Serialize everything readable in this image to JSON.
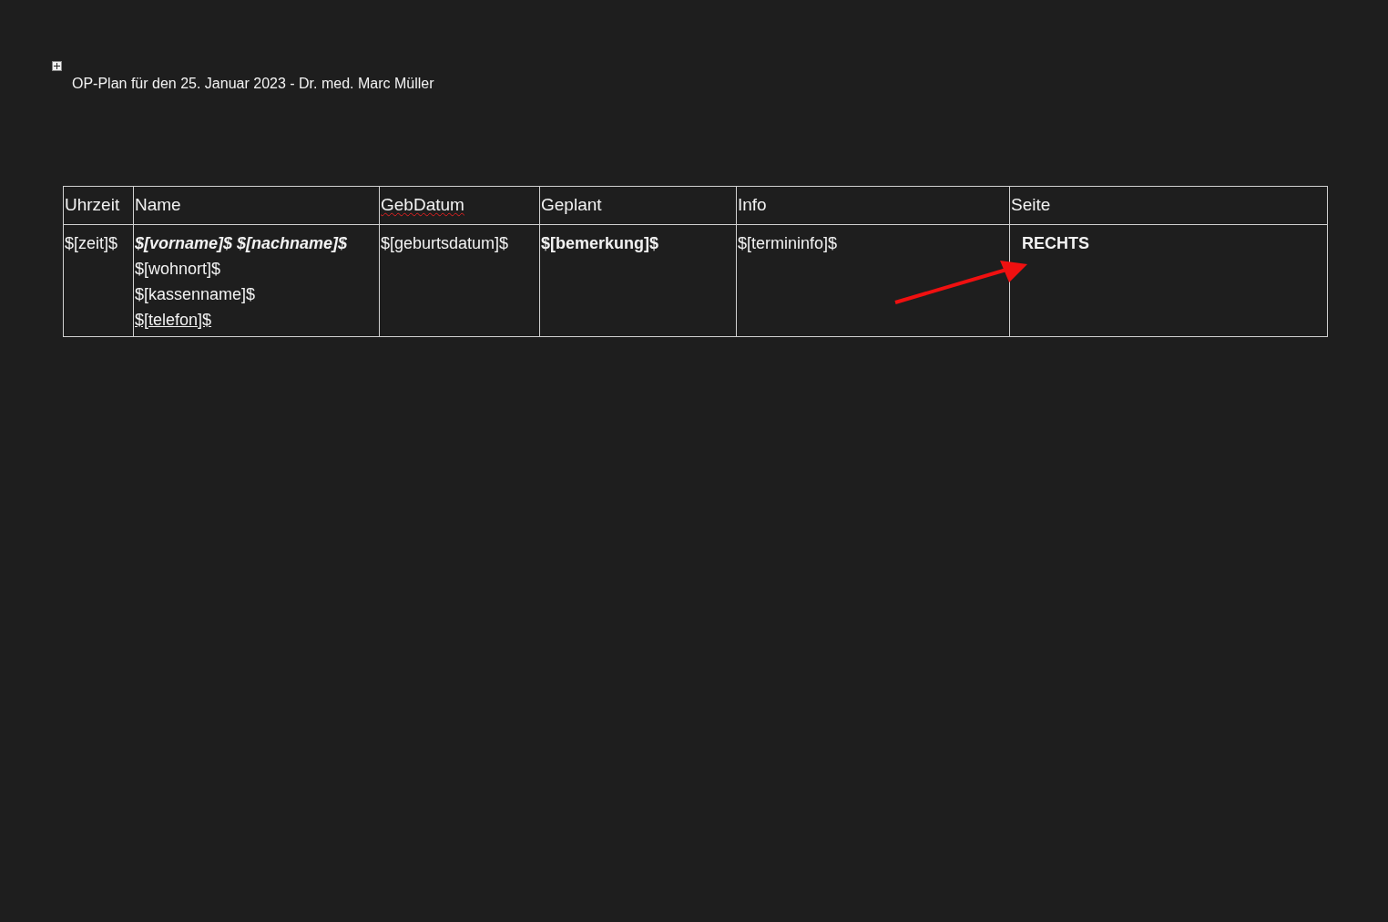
{
  "document": {
    "title": "OP-Plan für den 25. Januar 2023 - Dr. med. Marc Müller"
  },
  "table": {
    "columns": [
      {
        "label": "Uhrzeit",
        "misspelled": false
      },
      {
        "label": "Name",
        "misspelled": false
      },
      {
        "label": "GebDatum",
        "misspelled": true
      },
      {
        "label": "Geplant",
        "misspelled": false
      },
      {
        "label": "Info",
        "misspelled": false
      },
      {
        "label": "Seite",
        "misspelled": false
      }
    ],
    "rows": [
      {
        "cells": [
          [
            {
              "text": "$[zeit]$",
              "kind": "plain"
            }
          ],
          [
            {
              "text": "$[vorname]$ $[nachname]$",
              "kind": "bolditalic"
            },
            {
              "text": "$[wohnort]$",
              "kind": "plain"
            },
            {
              "text": "$[kassenname]$",
              "kind": "plain"
            },
            {
              "text": "$[telefon]$",
              "kind": "underline"
            }
          ],
          [
            {
              "text": "$[geburtsdatum]$",
              "kind": "plain"
            }
          ],
          [
            {
              "text": "$[bemerkung]$",
              "kind": "bold"
            }
          ],
          [
            {
              "text": "$[termininfo]$",
              "kind": "plain"
            }
          ],
          [
            {
              "text": "RECHTS",
              "kind": "bold"
            }
          ]
        ]
      }
    ]
  }
}
